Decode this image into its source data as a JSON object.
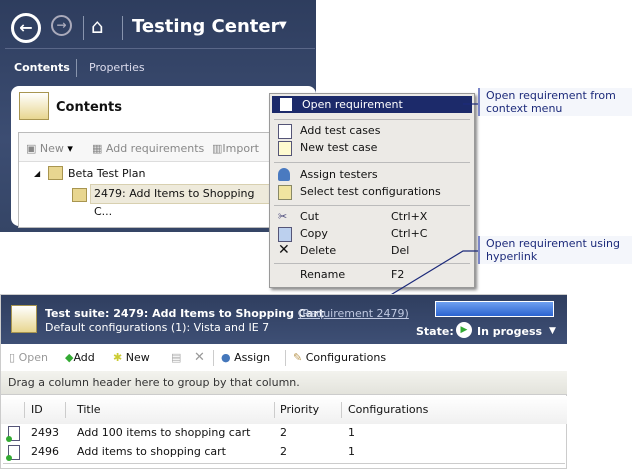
{
  "app": {
    "title": "Testing Center",
    "tabs": [
      "Contents",
      "Properties"
    ]
  },
  "contents": {
    "heading": "Contents",
    "toolbar": {
      "new": "New",
      "add_requirements": "Add requirements",
      "import": "Import"
    },
    "tree": {
      "root": "Beta Test Plan",
      "child": "2479: Add Items to Shopping C..."
    }
  },
  "context_menu": [
    {
      "label": "Open requirement",
      "shortcut": ""
    },
    {
      "label": "Add test cases",
      "shortcut": ""
    },
    {
      "label": "New test case",
      "shortcut": ""
    },
    {
      "label": "Assign testers",
      "shortcut": ""
    },
    {
      "label": "Select test configurations",
      "shortcut": ""
    },
    {
      "label": "Cut",
      "shortcut": "Ctrl+X"
    },
    {
      "label": "Copy",
      "shortcut": "Ctrl+C"
    },
    {
      "label": "Delete",
      "shortcut": "Del"
    },
    {
      "label": "Rename",
      "shortcut": "F2"
    }
  ],
  "callouts": [
    "Open requirement from context menu",
    "Open requirement using hyperlink"
  ],
  "suite": {
    "title": "Test suite:  2479: Add Items to Shopping Cart",
    "link": "(Requirement 2479)",
    "configs": "Default configurations (1): Vista and IE 7",
    "state_label": "State:",
    "state": "In progess",
    "toolbar": {
      "open": "Open",
      "add": "Add",
      "new": "New",
      "assign": "Assign",
      "configurations": "Configurations"
    },
    "group_hint": "Drag a column header here to group by that column.",
    "columns": [
      "ID",
      "Title",
      "Priority",
      "Configurations"
    ],
    "rows": [
      {
        "id": "2493",
        "title": "Add 100 items to shopping cart",
        "priority": "2",
        "configs": "1"
      },
      {
        "id": "2496",
        "title": "Add items to shopping cart",
        "priority": "2",
        "configs": "1"
      }
    ]
  }
}
